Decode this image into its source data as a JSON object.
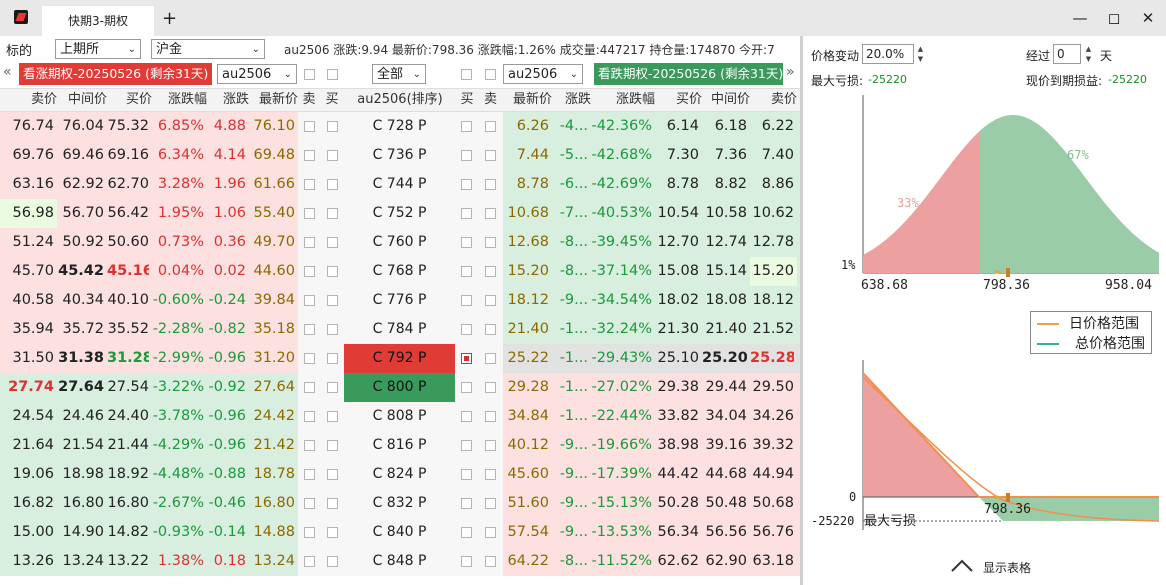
{
  "window": {
    "tab_title": "快期3-期权",
    "new_tab": "+",
    "min_icon": "minimize-icon",
    "max_icon": "maximize-icon",
    "close_icon": "close-icon"
  },
  "filters": {
    "label": "标的",
    "exchange": "上期所",
    "product": "沪金",
    "quote_text": "au2506 涨跌:9.94 最新价:798.36 涨跌幅:1.26% 成交量:447217 持仓量:174870 今开:7"
  },
  "call_header": {
    "banner": "看涨期权-20250526 (剩余31天)",
    "contract": "au2506"
  },
  "put_header": {
    "banner": "看跌期权-20250526 (剩余31天)",
    "contract": "au2506"
  },
  "center": {
    "scope": "全部"
  },
  "columns": {
    "call": [
      "卖价",
      "中间价",
      "买价",
      "涨跌幅",
      "涨跌",
      "最新价",
      "卖",
      "买"
    ],
    "strike": "au2506(排序)",
    "put": [
      "买",
      "卖",
      "最新价",
      "涨跌",
      "涨跌幅",
      "买价",
      "中间价",
      "卖价"
    ]
  },
  "rows": [
    {
      "c_ask": "76.74",
      "c_mid": "76.04",
      "c_bid": "75.32",
      "c_pct": "6.85%",
      "c_chg": "4.88",
      "c_last": "76.10",
      "k": "C  728  P",
      "p_last": "6.26",
      "p_chg": "-4...",
      "p_pct": "-42.36%",
      "p_bid": "6.14",
      "p_mid": "6.18",
      "p_ask": "6.22"
    },
    {
      "c_ask": "69.76",
      "c_mid": "69.46",
      "c_bid": "69.16",
      "c_pct": "6.34%",
      "c_chg": "4.14",
      "c_last": "69.48",
      "k": "C  736  P",
      "p_last": "7.44",
      "p_chg": "-5...",
      "p_pct": "-42.68%",
      "p_bid": "7.30",
      "p_mid": "7.36",
      "p_ask": "7.40"
    },
    {
      "c_ask": "63.16",
      "c_mid": "62.92",
      "c_bid": "62.70",
      "c_pct": "3.28%",
      "c_chg": "1.96",
      "c_last": "61.66",
      "k": "C  744  P",
      "p_last": "8.78",
      "p_chg": "-6...",
      "p_pct": "-42.69%",
      "p_bid": "8.78",
      "p_mid": "8.82",
      "p_ask": "8.86"
    },
    {
      "c_ask": "56.98",
      "c_mid": "56.70",
      "c_bid": "56.42",
      "c_pct": "1.95%",
      "c_chg": "1.06",
      "c_last": "55.40",
      "k": "C  752  P",
      "p_last": "10.68",
      "p_chg": "-7...",
      "p_pct": "-40.53%",
      "p_bid": "10.54",
      "p_mid": "10.58",
      "p_ask": "10.62"
    },
    {
      "c_ask": "51.24",
      "c_mid": "50.92",
      "c_bid": "50.60",
      "c_pct": "0.73%",
      "c_chg": "0.36",
      "c_last": "49.70",
      "k": "C  760  P",
      "p_last": "12.68",
      "p_chg": "-8...",
      "p_pct": "-39.45%",
      "p_bid": "12.70",
      "p_mid": "12.74",
      "p_ask": "12.78"
    },
    {
      "c_ask": "45.70",
      "c_mid": "45.42",
      "c_bid": "45.16",
      "c_pct": "0.04%",
      "c_chg": "0.02",
      "c_last": "44.60",
      "k": "C  768  P",
      "p_last": "15.20",
      "p_chg": "-8...",
      "p_pct": "-37.14%",
      "p_bid": "15.08",
      "p_mid": "15.14",
      "p_ask": "15.20"
    },
    {
      "c_ask": "40.58",
      "c_mid": "40.34",
      "c_bid": "40.10",
      "c_pct": "-0.60%",
      "c_chg": "-0.24",
      "c_last": "39.84",
      "k": "C  776  P",
      "p_last": "18.12",
      "p_chg": "-9...",
      "p_pct": "-34.54%",
      "p_bid": "18.02",
      "p_mid": "18.08",
      "p_ask": "18.12"
    },
    {
      "c_ask": "35.94",
      "c_mid": "35.72",
      "c_bid": "35.52",
      "c_pct": "-2.28%",
      "c_chg": "-0.82",
      "c_last": "35.18",
      "k": "C  784  P",
      "p_last": "21.40",
      "p_chg": "-1...",
      "p_pct": "-32.24%",
      "p_bid": "21.30",
      "p_mid": "21.40",
      "p_ask": "21.52"
    },
    {
      "c_ask": "31.50",
      "c_mid": "31.38",
      "c_bid": "31.28",
      "c_pct": "-2.99%",
      "c_chg": "-0.96",
      "c_last": "31.20",
      "k": "C  792  P",
      "p_last": "25.22",
      "p_chg": "-1...",
      "p_pct": "-29.43%",
      "p_bid": "25.10",
      "p_mid": "25.20",
      "p_ask": "25.28"
    },
    {
      "c_ask": "27.74",
      "c_mid": "27.64",
      "c_bid": "27.54",
      "c_pct": "-3.22%",
      "c_chg": "-0.92",
      "c_last": "27.64",
      "k": "C  800  P",
      "p_last": "29.28",
      "p_chg": "-1...",
      "p_pct": "-27.02%",
      "p_bid": "29.38",
      "p_mid": "29.44",
      "p_ask": "29.50"
    },
    {
      "c_ask": "24.54",
      "c_mid": "24.46",
      "c_bid": "24.40",
      "c_pct": "-3.78%",
      "c_chg": "-0.96",
      "c_last": "24.42",
      "k": "C  808  P",
      "p_last": "34.84",
      "p_chg": "-1...",
      "p_pct": "-22.44%",
      "p_bid": "33.82",
      "p_mid": "34.04",
      "p_ask": "34.26"
    },
    {
      "c_ask": "21.64",
      "c_mid": "21.54",
      "c_bid": "21.44",
      "c_pct": "-4.29%",
      "c_chg": "-0.96",
      "c_last": "21.42",
      "k": "C  816  P",
      "p_last": "40.12",
      "p_chg": "-9...",
      "p_pct": "-19.66%",
      "p_bid": "38.98",
      "p_mid": "39.16",
      "p_ask": "39.32"
    },
    {
      "c_ask": "19.06",
      "c_mid": "18.98",
      "c_bid": "18.92",
      "c_pct": "-4.48%",
      "c_chg": "-0.88",
      "c_last": "18.78",
      "k": "C  824  P",
      "p_last": "45.60",
      "p_chg": "-9...",
      "p_pct": "-17.39%",
      "p_bid": "44.42",
      "p_mid": "44.68",
      "p_ask": "44.94"
    },
    {
      "c_ask": "16.82",
      "c_mid": "16.80",
      "c_bid": "16.80",
      "c_pct": "-2.67%",
      "c_chg": "-0.46",
      "c_last": "16.80",
      "k": "C  832  P",
      "p_last": "51.60",
      "p_chg": "-9...",
      "p_pct": "-15.13%",
      "p_bid": "50.28",
      "p_mid": "50.48",
      "p_ask": "50.68"
    },
    {
      "c_ask": "15.00",
      "c_mid": "14.90",
      "c_bid": "14.82",
      "c_pct": "-0.93%",
      "c_chg": "-0.14",
      "c_last": "14.88",
      "k": "C  840  P",
      "p_last": "57.54",
      "p_chg": "-9...",
      "p_pct": "-13.53%",
      "p_bid": "56.34",
      "p_mid": "56.56",
      "p_ask": "56.76"
    },
    {
      "c_ask": "13.26",
      "c_mid": "13.24",
      "c_bid": "13.22",
      "c_pct": "1.38%",
      "c_chg": "0.18",
      "c_last": "13.24",
      "k": "C  848  P",
      "p_last": "64.22",
      "p_chg": "-8...",
      "p_pct": "-11.52%",
      "p_bid": "62.62",
      "p_mid": "62.90",
      "p_ask": "63.18"
    }
  ],
  "right_panel": {
    "price_change_label": "价格变动",
    "price_change_value": "20.0%",
    "days_label": "经过",
    "days_value": "0",
    "days_unit": "天",
    "max_loss_label": "最大亏损:",
    "max_loss_value": "-25220",
    "pnl_label": "现价到期损益:",
    "pnl_value": "-25220",
    "dist": {
      "left_pct": "33%",
      "right_pct": "67%",
      "y_label": "1%",
      "x_min": "638.68",
      "x_mid": "798.36",
      "x_max": "958.04"
    },
    "legend": {
      "day_range": "日价格范围",
      "total_range": "总价格范围"
    },
    "pnl_chart": {
      "zero": "0",
      "x_mid": "798.36",
      "loss_value": "-25220",
      "loss_label": "最大亏损"
    },
    "show_table": "显示表格"
  }
}
